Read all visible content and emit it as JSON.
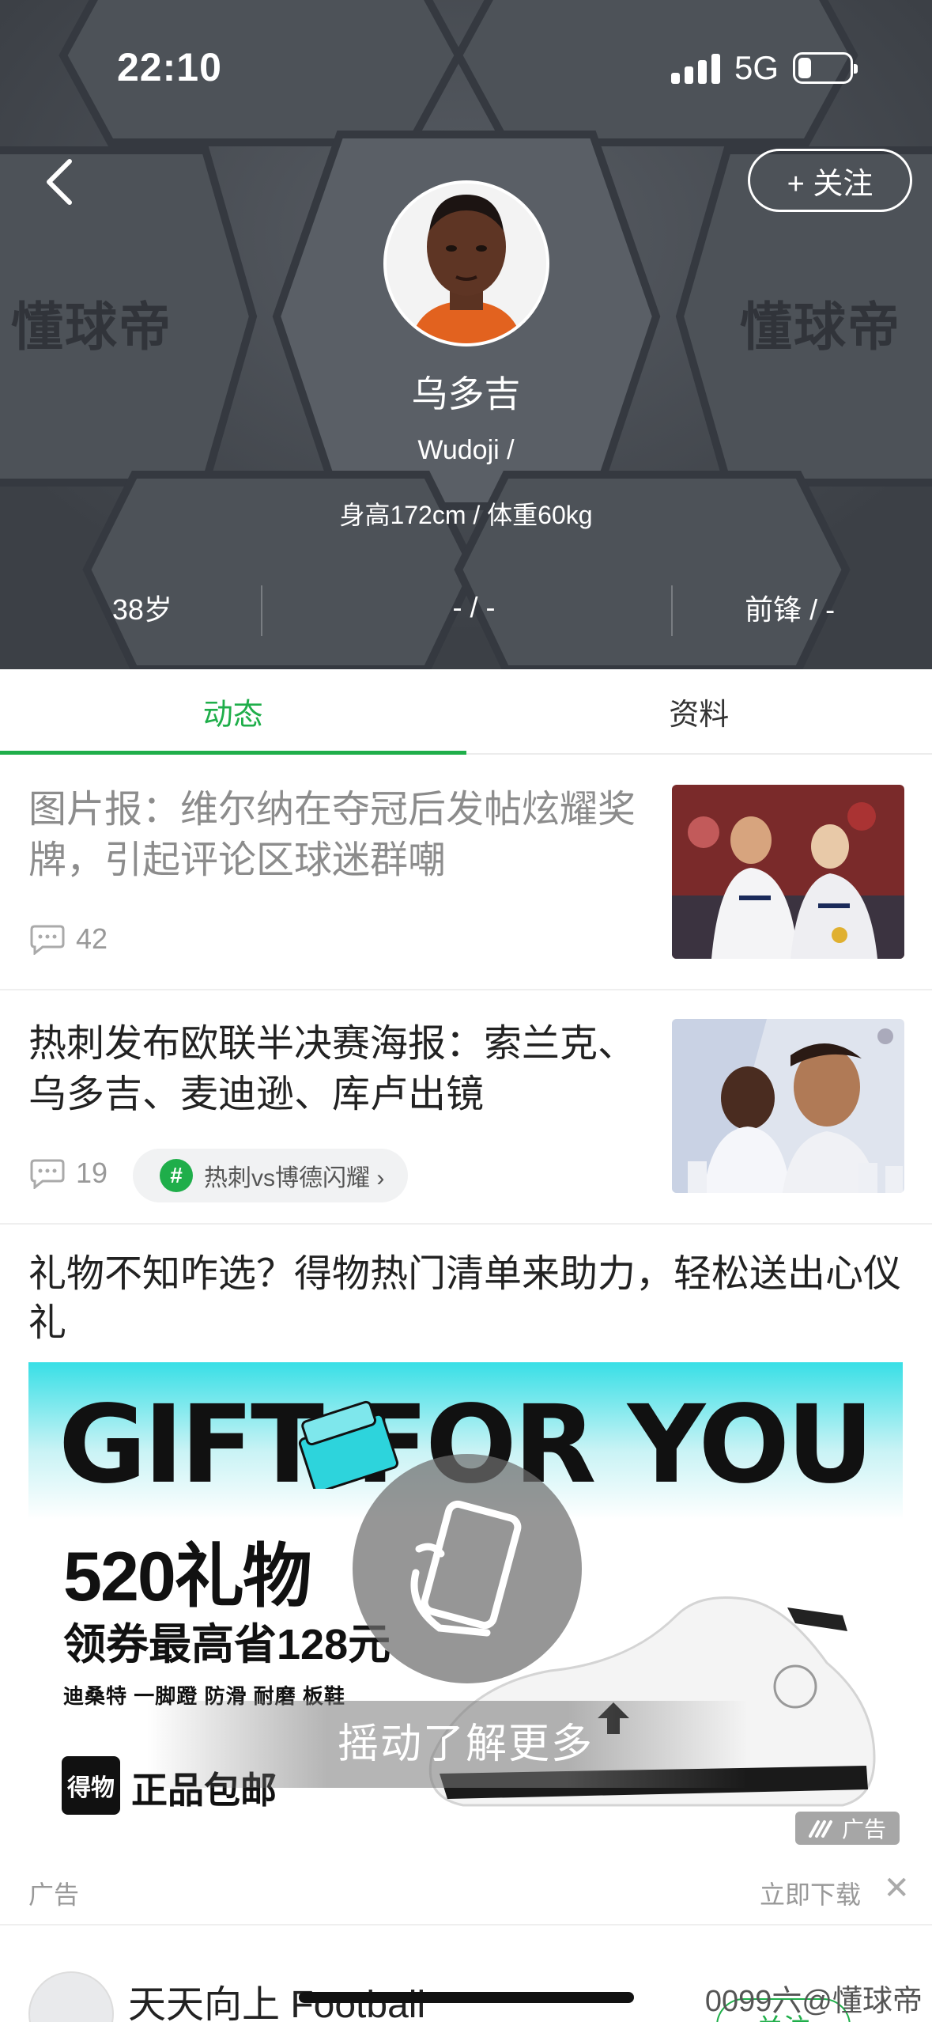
{
  "status_bar": {
    "time": "22:10",
    "network": "5G"
  },
  "header": {
    "follow_label": "+ 关注",
    "watermark_text": "懂球帝",
    "player": {
      "name_cn": "乌多吉",
      "name_en": "Wudoji /",
      "body": "身高172cm / 体重60kg",
      "stats": [
        "38岁",
        "- / -",
        "前锋 / -"
      ]
    }
  },
  "tabs": [
    {
      "label": "动态",
      "active": true
    },
    {
      "label": "资料",
      "active": false
    }
  ],
  "feed": [
    {
      "title": "图片报：维尔纳在夺冠后发帖炫耀奖牌，引起评论区球迷群嘲",
      "comments": "42",
      "read": true
    },
    {
      "title": "热刺发布欧联半决赛海报：索兰克、乌多吉、麦迪逊、库卢出镜",
      "comments": "19",
      "topic": "热刺vs博德闪耀 ›",
      "read": false
    }
  ],
  "ad": {
    "title": "礼物不知咋选？得物热门清单来助力，轻松送出心仪礼",
    "banner": {
      "headline": "GIFT FOR YOU",
      "big": "520礼物",
      "sub": "领券最高省128元",
      "tags": "迪桑特 一脚蹬 防滑 耐磨 板鞋",
      "logo": "得物",
      "genuine": "正品包邮",
      "shake": "摇动了解更多",
      "mark": "广告"
    },
    "label": "广告",
    "download": "立即下载",
    "close": "✕"
  },
  "next_item": {
    "name": "天天向上 Football",
    "follow": "关注"
  },
  "corner_watermark": "0099六@懂球帝",
  "colors": {
    "accent": "#1fae4a",
    "header_bg": "#3f4349"
  }
}
